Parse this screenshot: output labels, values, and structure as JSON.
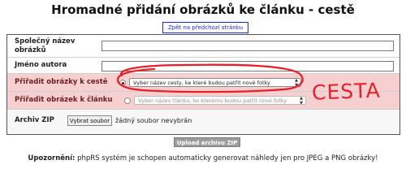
{
  "page": {
    "title": "Hromadné přidání obrázků ke článku - cestě",
    "back_link": "Zpět na předchozí stránku"
  },
  "form": {
    "common_name_label": "Společný název obrázků",
    "common_name_value": "",
    "author_label": "Jméno autora",
    "author_value": "",
    "assign_trip_label": "Přiřadit obrázky k cestě",
    "trip_select_value": "Vyber název cesty, ke které budou patřit nové fotky",
    "trip_radio_checked": true,
    "assign_article_label": "Přiřadit obrázek k článku",
    "article_select_value": "Vyber název článku, ke kterému budou patřit nové fotky",
    "article_radio_checked": false,
    "zip_label": "Archiv ZIP",
    "file_button_label": "Vybrat soubor",
    "file_status": "žádný soubor nevybrán",
    "submit_label": "Upload archivu ZIP"
  },
  "note": {
    "prefix": "Upozornění:",
    "text": " phpRS systém je schopen automaticky generovat náhledy jen pro JPEG a PNG obrázky!"
  },
  "annotation": {
    "handwritten_text": "CESTA",
    "color": "#e8202a"
  },
  "colors": {
    "highlight_row": "#f6d0d0",
    "link_blue": "#1b2bd6",
    "button_gray": "#9c9c9c"
  }
}
